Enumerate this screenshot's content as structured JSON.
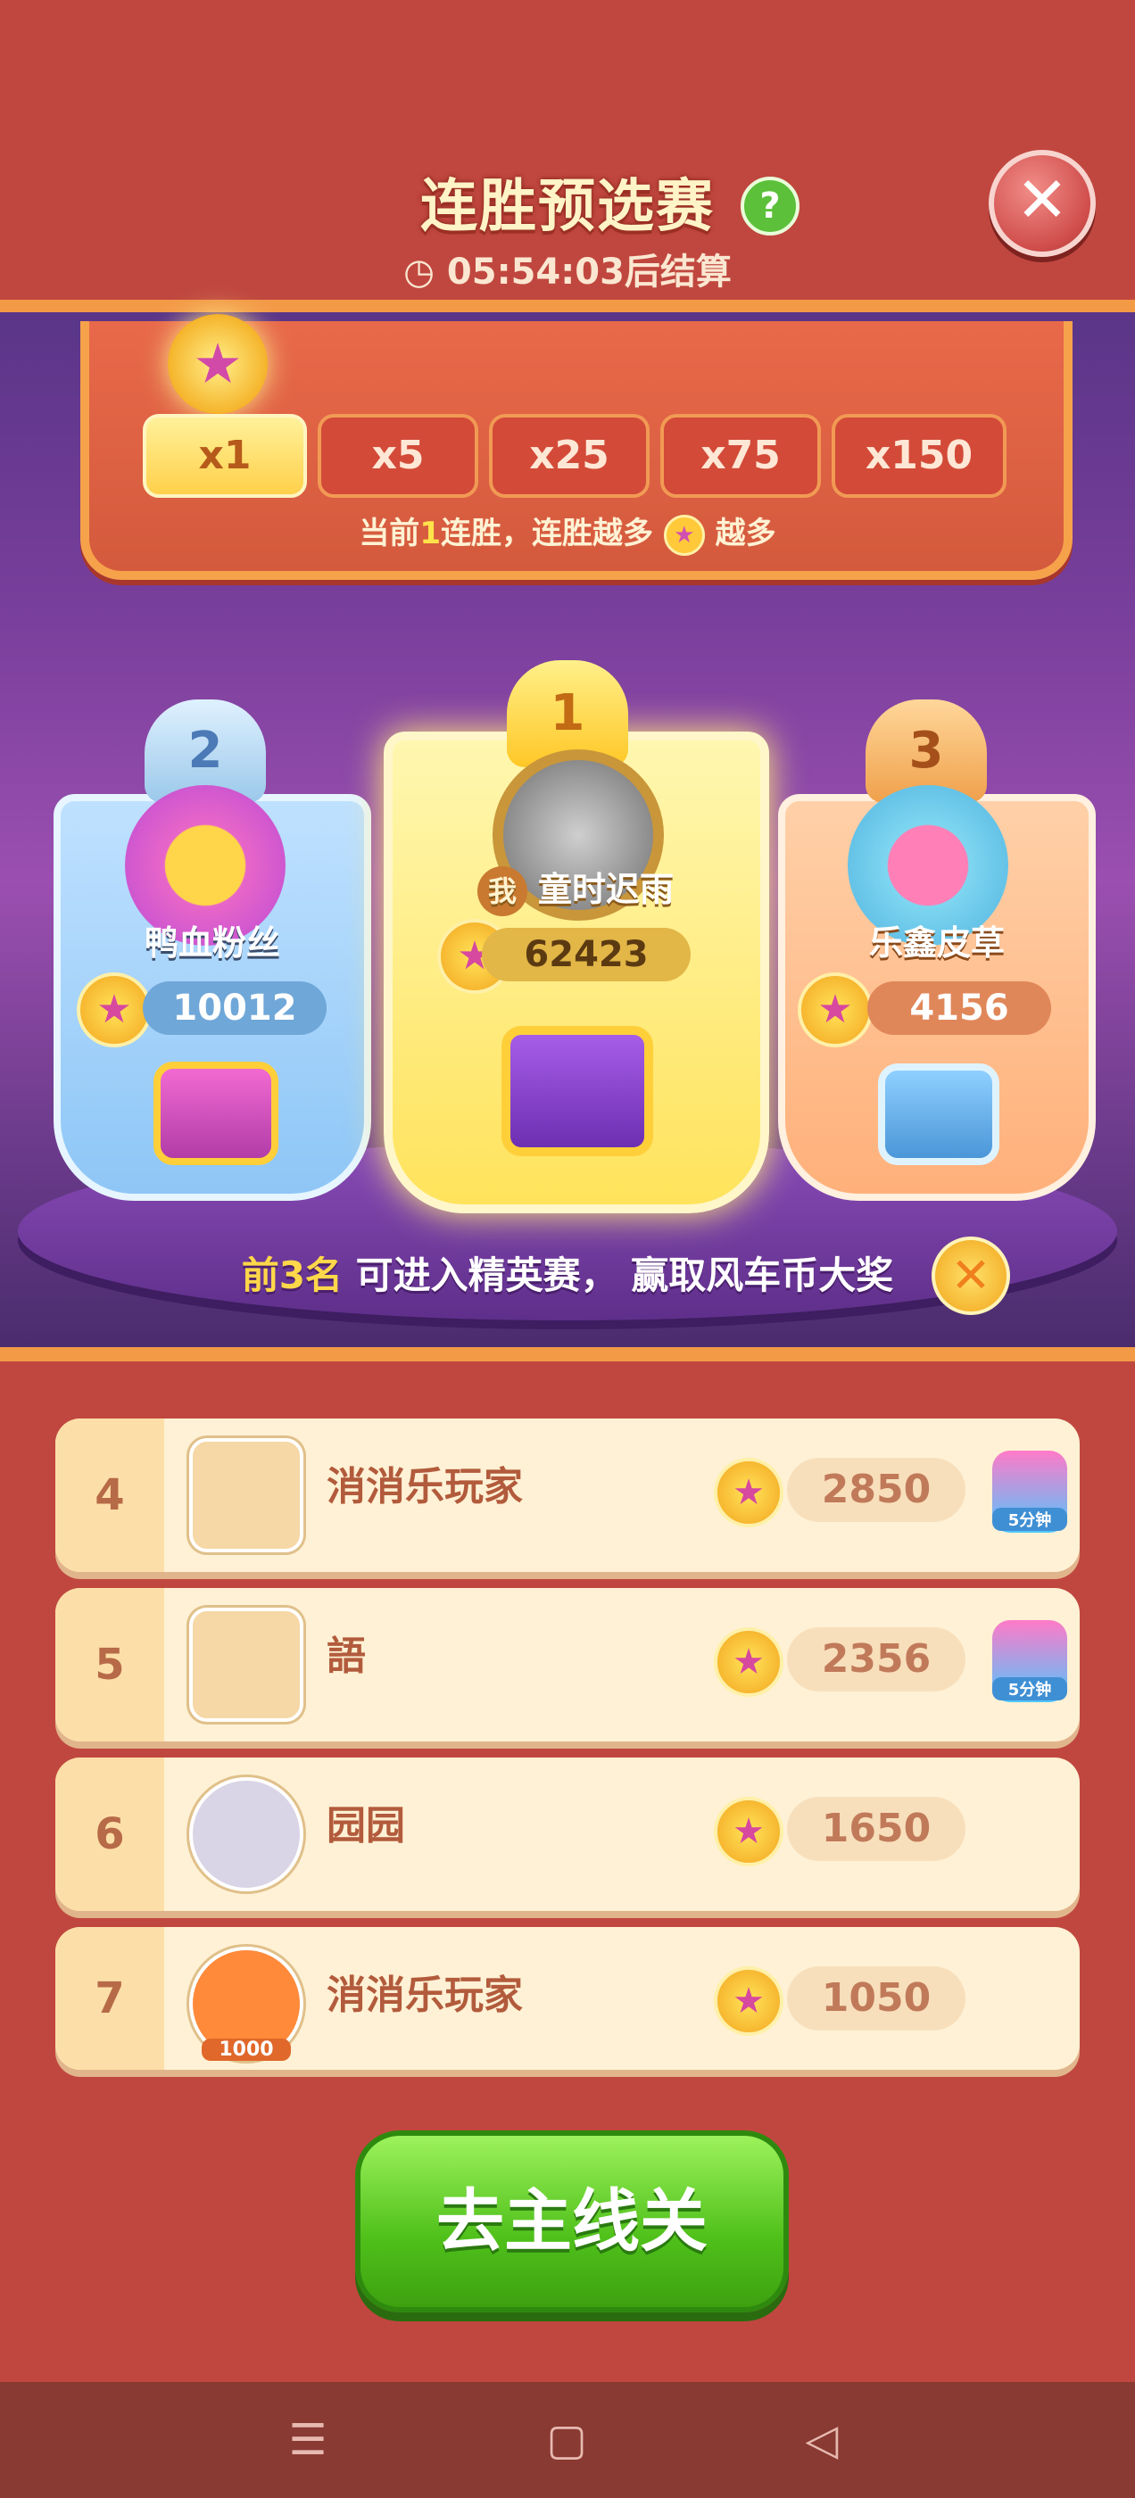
{
  "header": {
    "title": "连胜预选赛",
    "help_label": "?",
    "timer_text": "05:54:03后结算",
    "clock_icon": "◷",
    "close_label": "✕"
  },
  "streak": {
    "steps": [
      "x1",
      "x5",
      "x25",
      "x75",
      "x150"
    ],
    "active_index": 0,
    "note_prefix": "当前",
    "note_number": "1",
    "note_middle": "连胜，连胜越多",
    "note_suffix": "越多"
  },
  "podium": {
    "first": {
      "rank": "1",
      "me_label": "我",
      "name": "童时迟雨",
      "score": "62423"
    },
    "second": {
      "rank": "2",
      "name": "鸭血粉丝",
      "score": "10012"
    },
    "third": {
      "rank": "3",
      "name": "乐鑫皮草",
      "score": "4156"
    },
    "note_bold": "前3名",
    "note_rest": " 可进入精英赛， 赢取风车币大奖"
  },
  "leaderboard": [
    {
      "rank": "4",
      "name": "消消乐玩家",
      "score": "2850",
      "badge": "5分钟"
    },
    {
      "rank": "5",
      "name": "語",
      "score": "2356",
      "badge": "5分钟"
    },
    {
      "rank": "6",
      "name": "园园",
      "score": "1650",
      "badge": ""
    },
    {
      "rank": "7",
      "name": "消消乐玩家",
      "score": "1050",
      "badge": ""
    }
  ],
  "avatar_tag": "1000",
  "go_button": "去主线关",
  "navbar": {
    "menu_icon": "☰",
    "home_icon": "▢",
    "back_icon": "◁"
  },
  "colors": {
    "background": "#c0473f",
    "accent_orange": "#f39a47",
    "go_green": "#4fc01a"
  }
}
